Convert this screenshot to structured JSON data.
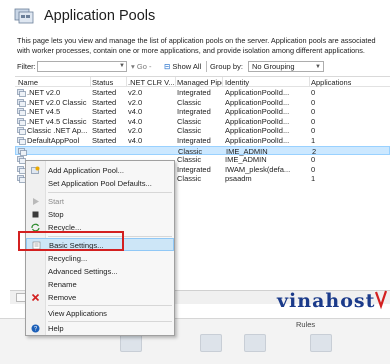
{
  "header": {
    "title": "Application Pools"
  },
  "description": "This page lets you view and manage the list of application pools on the server. Application pools are associated with worker processes, contain one or more applications, and provide isolation among different applications.",
  "filterbar": {
    "filter_label": "Filter:",
    "filter_value": "",
    "go_label": "Go",
    "show_all_label": "Show All",
    "group_by_label": "Group by:",
    "group_by_value": "No Grouping"
  },
  "grid": {
    "columns": [
      "Name",
      "Status",
      ".NET CLR V...",
      "Managed Pipel...",
      "Identity",
      "Applications"
    ],
    "rows": [
      {
        "name": ".NET v2.0",
        "status": "Started",
        "clr": "v2.0",
        "pipeline": "Integrated",
        "identity": "ApplicationPoolId...",
        "apps": "0"
      },
      {
        "name": ".NET v2.0 Classic",
        "status": "Started",
        "clr": "v2.0",
        "pipeline": "Classic",
        "identity": "ApplicationPoolId...",
        "apps": "0"
      },
      {
        "name": ".NET v4.5",
        "status": "Started",
        "clr": "v4.0",
        "pipeline": "Integrated",
        "identity": "ApplicationPoolId...",
        "apps": "0"
      },
      {
        "name": ".NET v4.5 Classic",
        "status": "Started",
        "clr": "v4.0",
        "pipeline": "Classic",
        "identity": "ApplicationPoolId...",
        "apps": "0"
      },
      {
        "name": "Classic .NET Ap...",
        "status": "Started",
        "clr": "v2.0",
        "pipeline": "Classic",
        "identity": "ApplicationPoolId...",
        "apps": "0"
      },
      {
        "name": "DefaultAppPool",
        "status": "Started",
        "clr": "v4.0",
        "pipeline": "Integrated",
        "identity": "ApplicationPoolId...",
        "apps": "1"
      },
      {
        "name": "",
        "status": "",
        "clr": "",
        "pipeline": "Classic",
        "identity": "IME_ADMIN",
        "apps": "2"
      },
      {
        "name": "",
        "status": "",
        "clr": "",
        "pipeline": "Classic",
        "identity": "IME_ADMIN",
        "apps": "0"
      },
      {
        "name": "",
        "status": "",
        "clr": "",
        "pipeline": "Integrated",
        "identity": "IWAM_plesk(defa...",
        "apps": "0"
      },
      {
        "name": "",
        "status": "",
        "clr": "",
        "pipeline": "Classic",
        "identity": "psaadm",
        "apps": "1"
      }
    ]
  },
  "context_menu": {
    "items": [
      {
        "label": "Add Application Pool...",
        "icon": "add-pool-icon",
        "disabled": false
      },
      {
        "label": "Set Application Pool Defaults...",
        "icon": "",
        "disabled": false
      },
      {
        "label": "Start",
        "icon": "start-icon",
        "disabled": true
      },
      {
        "label": "Stop",
        "icon": "stop-icon",
        "disabled": false
      },
      {
        "label": "Recycle...",
        "icon": "recycle-icon",
        "disabled": false
      },
      {
        "label": "Basic Settings...",
        "icon": "settings-icon",
        "disabled": false
      },
      {
        "label": "Recycling...",
        "icon": "",
        "disabled": false
      },
      {
        "label": "Advanced Settings...",
        "icon": "",
        "disabled": false
      },
      {
        "label": "Rename",
        "icon": "",
        "disabled": false
      },
      {
        "label": "Remove",
        "icon": "remove-icon",
        "disabled": false
      },
      {
        "label": "View Applications",
        "icon": "",
        "disabled": false
      },
      {
        "label": "Help",
        "icon": "help-icon",
        "disabled": false
      }
    ]
  },
  "bottom": {
    "pane_label": "B",
    "rules_label": "Rules"
  },
  "watermark": {
    "text": "vinahost",
    "subtext": ""
  },
  "colors": {
    "selection": "#cce8ff",
    "highlight_border": "#d32020",
    "accent": "#0078d7"
  }
}
